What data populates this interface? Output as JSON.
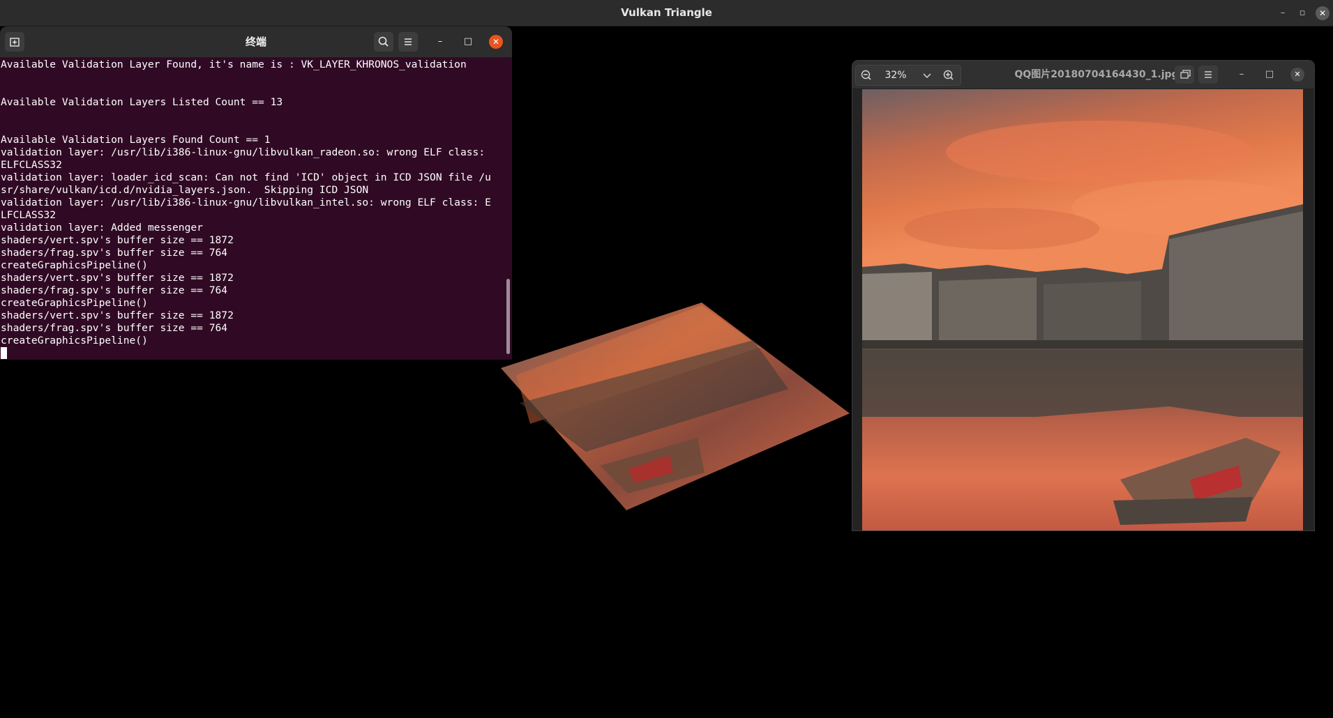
{
  "window": {
    "title": "Vulkan Triangle",
    "controls": {
      "minimize": "–",
      "restore": "▫",
      "close": "✕"
    }
  },
  "terminal": {
    "title": "终端",
    "lines": [
      "Available Validation Layer Found, it's name is : VK_LAYER_KHRONOS_validation",
      "",
      "",
      "Available Validation Layers Listed Count == 13",
      "",
      "",
      "Available Validation Layers Found Count == 1",
      "validation layer: /usr/lib/i386-linux-gnu/libvulkan_radeon.so: wrong ELF class:",
      "ELFCLASS32",
      "validation layer: loader_icd_scan: Can not find 'ICD' object in ICD JSON file /u",
      "sr/share/vulkan/icd.d/nvidia_layers.json.  Skipping ICD JSON",
      "validation layer: /usr/lib/i386-linux-gnu/libvulkan_intel.so: wrong ELF class: E",
      "LFCLASS32",
      "validation layer: Added messenger",
      "shaders/vert.spv's buffer size == 1872",
      "shaders/frag.spv's buffer size == 764",
      "createGraphicsPipeline()",
      "shaders/vert.spv's buffer size == 1872",
      "shaders/frag.spv's buffer size == 764",
      "createGraphicsPipeline()",
      "shaders/vert.spv's buffer size == 1872",
      "shaders/frag.spv's buffer size == 764",
      "createGraphicsPipeline()"
    ],
    "icons": {
      "new_tab": "new-tab-icon",
      "search": "search-icon",
      "menu": "hamburger-menu-icon"
    },
    "controls": {
      "minimize": "–",
      "maximize": "□",
      "close": "✕"
    },
    "colors": {
      "background": "#300a24",
      "close_button": "#e95420"
    }
  },
  "viewer": {
    "title": "QQ图片20180704164430_1.jpg",
    "zoom_level": "32%",
    "icons": {
      "zoom_out": "zoom-out-icon",
      "zoom_dropdown": "chevron-down-icon",
      "zoom_in": "zoom-in-icon",
      "rotate": "rotate-icon",
      "menu": "hamburger-menu-icon"
    },
    "controls": {
      "minimize": "–",
      "maximize": "□",
      "close": "✕"
    }
  }
}
